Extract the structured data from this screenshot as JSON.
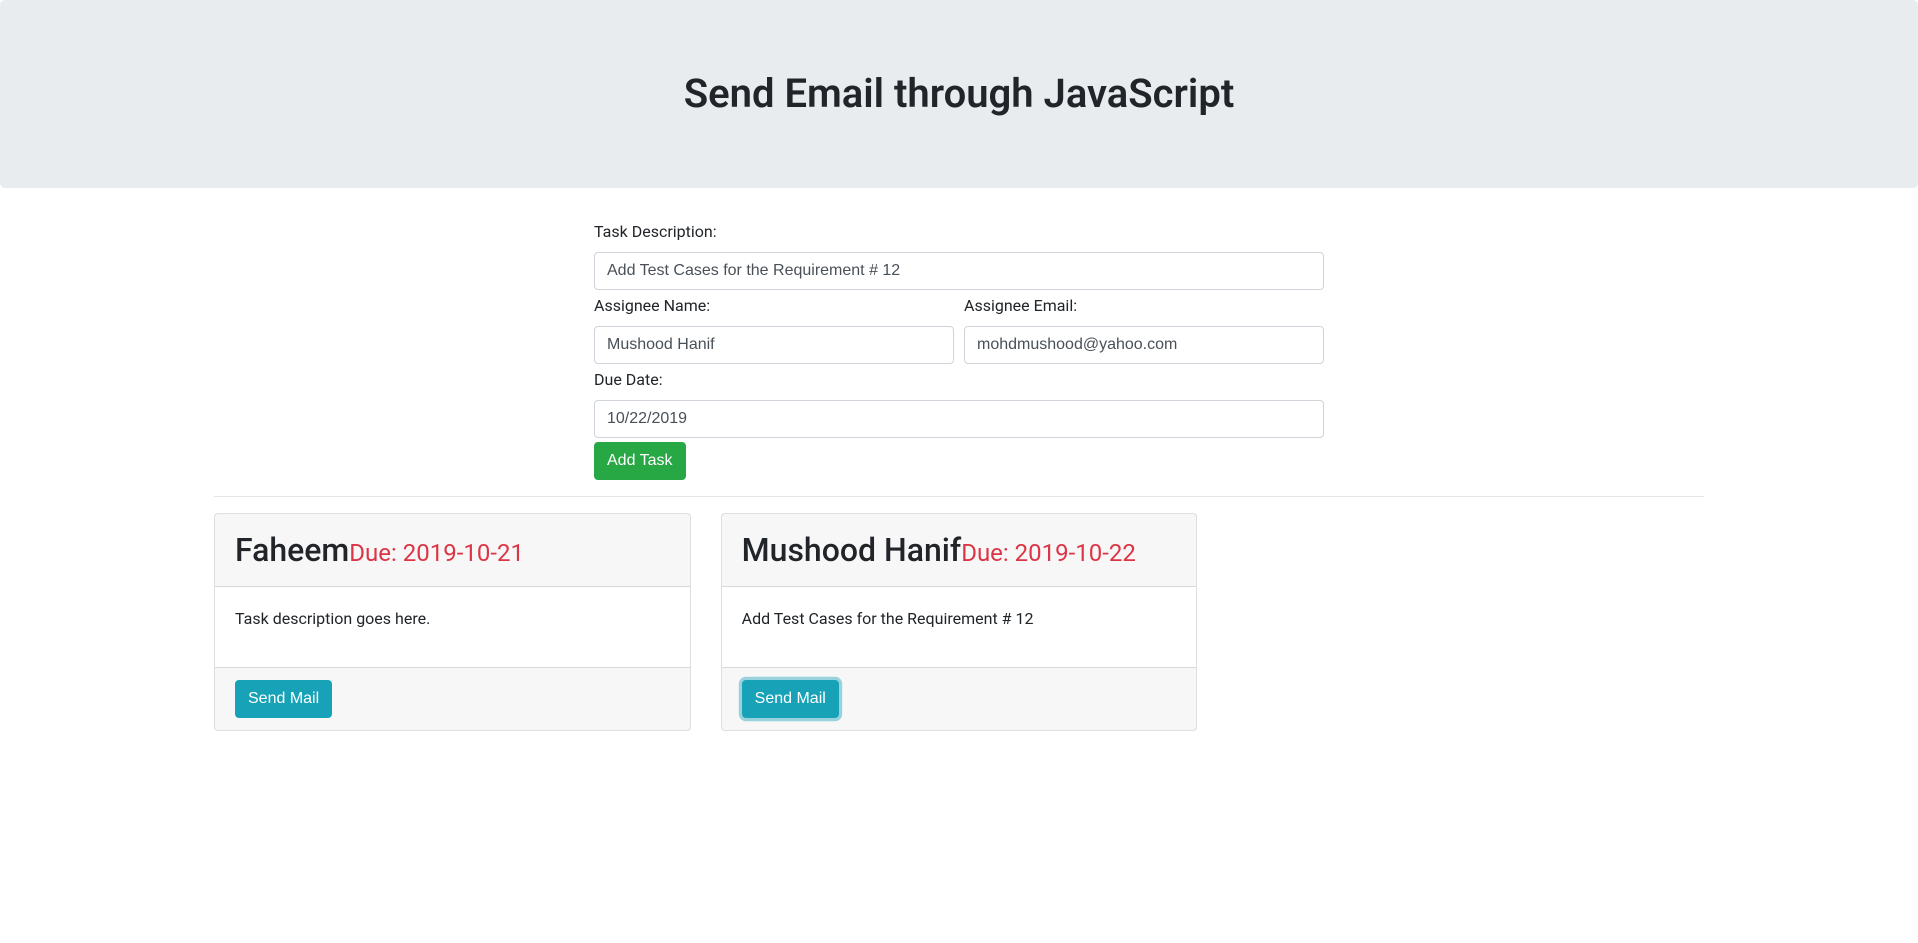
{
  "header": {
    "title": "Send Email through JavaScript"
  },
  "form": {
    "task_description_label": "Task Description:",
    "task_description_value": "Add Test Cases for the Requirement # 12",
    "assignee_name_label": "Assignee Name:",
    "assignee_name_value": "Mushood Hanif",
    "assignee_email_label": "Assignee Email:",
    "assignee_email_value": "mohdmushood@yahoo.com",
    "due_date_label": "Due Date:",
    "due_date_value": "10/22/2019",
    "add_task_button": "Add Task"
  },
  "cards": [
    {
      "name": "Faheem",
      "due_label": "Due: ",
      "due_date": "2019-10-21",
      "description": "Task description goes here.",
      "send_mail_button": "Send Mail",
      "focused": false
    },
    {
      "name": "Mushood Hanif",
      "due_label": "Due: ",
      "due_date": "2019-10-22",
      "description": "Add Test Cases for the Requirement # 12",
      "send_mail_button": "Send Mail",
      "focused": true
    }
  ],
  "colors": {
    "jumbotron_bg": "#e9ecef",
    "success": "#28a745",
    "info": "#17a2b8",
    "danger": "#dc3545"
  }
}
